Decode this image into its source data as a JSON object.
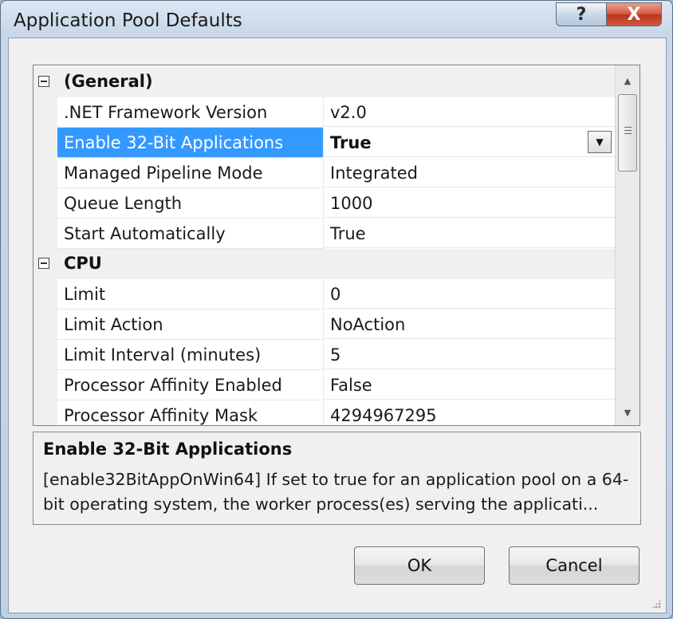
{
  "window": {
    "title": "Application Pool Defaults",
    "help_glyph": "?",
    "close_glyph": "X"
  },
  "grid": {
    "rows": [
      {
        "type": "category",
        "label": "(General)",
        "expanded": true
      },
      {
        "type": "property",
        "name": ".NET Framework Version",
        "value": "v2.0"
      },
      {
        "type": "property",
        "name": "Enable 32-Bit Applications",
        "value": "True",
        "selected": true
      },
      {
        "type": "property",
        "name": "Managed Pipeline Mode",
        "value": "Integrated"
      },
      {
        "type": "property",
        "name": "Queue Length",
        "value": "1000"
      },
      {
        "type": "property",
        "name": "Start Automatically",
        "value": "True"
      },
      {
        "type": "category",
        "label": "CPU",
        "expanded": true
      },
      {
        "type": "property",
        "name": "Limit",
        "value": "0"
      },
      {
        "type": "property",
        "name": "Limit Action",
        "value": "NoAction"
      },
      {
        "type": "property",
        "name": "Limit Interval (minutes)",
        "value": "5"
      },
      {
        "type": "property",
        "name": "Processor Affinity Enabled",
        "value": "False"
      },
      {
        "type": "property",
        "name": "Processor Affinity Mask",
        "value": "4294967295"
      }
    ],
    "dropdown_icon": "chevron-down-icon"
  },
  "description": {
    "title": "Enable 32-Bit Applications",
    "text": "[enable32BitAppOnWin64] If set to true for an application pool on a 64-bit operating system, the worker process(es) serving the applicati..."
  },
  "buttons": {
    "ok": "OK",
    "cancel": "Cancel"
  },
  "colors": {
    "selection": "#3399ff",
    "close_button": "#c9452a"
  }
}
